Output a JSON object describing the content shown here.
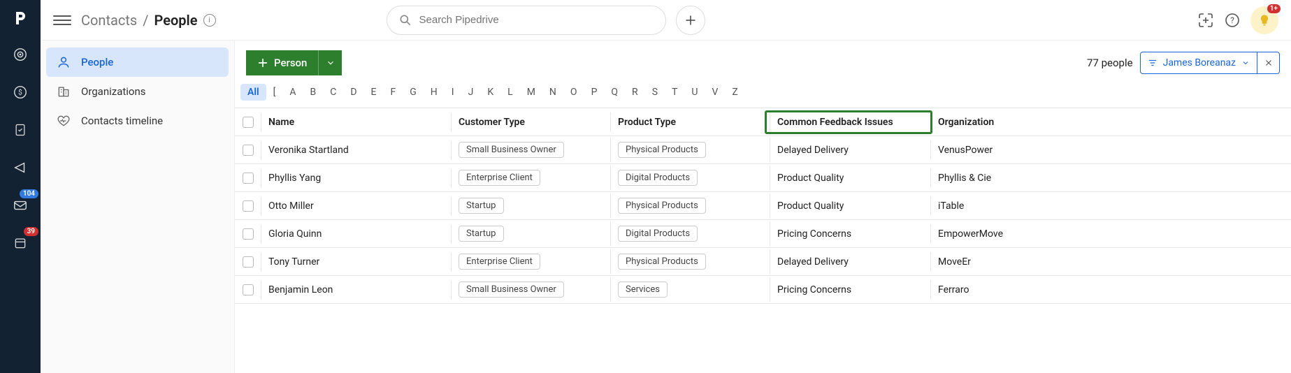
{
  "breadcrumb": {
    "parent": "Contacts",
    "current": "People"
  },
  "search": {
    "placeholder": "Search Pipedrive"
  },
  "rail_badges": {
    "inbox": "104",
    "calendar": "39"
  },
  "bulb_badge": "1+",
  "sidebar": {
    "items": [
      {
        "label": "People"
      },
      {
        "label": "Organizations"
      },
      {
        "label": "Contacts timeline"
      }
    ]
  },
  "toolbar": {
    "add_label": "Person",
    "count": "77 people",
    "filter_name": "James Boreanaz"
  },
  "alpha": [
    "All",
    "[",
    "A",
    "B",
    "C",
    "D",
    "E",
    "F",
    "G",
    "H",
    "I",
    "J",
    "K",
    "L",
    "M",
    "N",
    "O",
    "P",
    "Q",
    "R",
    "S",
    "T",
    "U",
    "V",
    "Z"
  ],
  "columns": {
    "name": "Name",
    "ctype": "Customer Type",
    "ptype": "Product Type",
    "feedback": "Common Feedback Issues",
    "org": "Organization"
  },
  "rows": [
    {
      "name": "Veronika Startland",
      "ctype": "Small Business Owner",
      "ptype": "Physical Products",
      "feedback": "Delayed Delivery",
      "org": "VenusPower"
    },
    {
      "name": "Phyllis Yang",
      "ctype": "Enterprise Client",
      "ptype": "Digital Products",
      "feedback": "Product Quality",
      "org": "Phyllis & Cie"
    },
    {
      "name": "Otto Miller",
      "ctype": "Startup",
      "ptype": "Physical Products",
      "feedback": "Product Quality",
      "org": "iTable"
    },
    {
      "name": "Gloria Quinn",
      "ctype": "Startup",
      "ptype": "Digital Products",
      "feedback": "Pricing Concerns",
      "org": "EmpowerMove"
    },
    {
      "name": "Tony Turner",
      "ctype": "Enterprise Client",
      "ptype": "Physical Products",
      "feedback": "Delayed Delivery",
      "org": "MoveEr"
    },
    {
      "name": "Benjamin Leon",
      "ctype": "Small Business Owner",
      "ptype": "Services",
      "feedback": "Pricing Concerns",
      "org": "Ferraro"
    }
  ]
}
